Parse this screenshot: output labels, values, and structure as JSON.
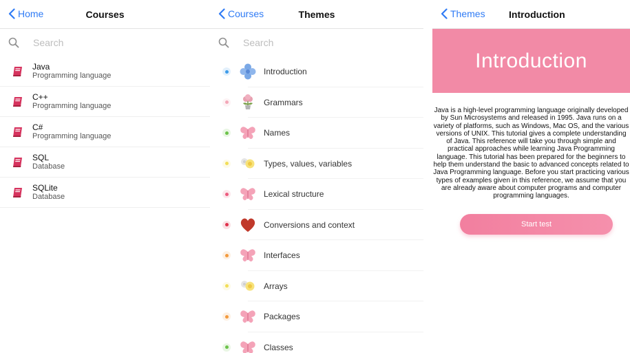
{
  "courses_screen": {
    "back_label": "Home",
    "title": "Courses",
    "search_placeholder": "Search",
    "items": [
      {
        "name": "Java",
        "subtitle": "Programming language"
      },
      {
        "name": "C++",
        "subtitle": "Programming language"
      },
      {
        "name": "C#",
        "subtitle": "Programming language"
      },
      {
        "name": "SQL",
        "subtitle": "Database"
      },
      {
        "name": "SQLite",
        "subtitle": "Database"
      }
    ]
  },
  "themes_screen": {
    "back_label": "Courses",
    "title": "Themes",
    "search_placeholder": "Search",
    "items": [
      {
        "label": "Introduction",
        "dot_color": "#3d9be9",
        "icon": "blue-flower-icon"
      },
      {
        "label": "Grammars",
        "dot_color": "#f3a7b8",
        "icon": "potted-flower-icon"
      },
      {
        "label": "Names",
        "dot_color": "#6cc24a",
        "icon": "pink-butterfly-icon"
      },
      {
        "label": "Types, values, variables",
        "dot_color": "#f2de57",
        "icon": "yellow-flower-icon"
      },
      {
        "label": "Lexical structure",
        "dot_color": "#ec5b7e",
        "icon": "pink-butterfly-icon"
      },
      {
        "label": "Conversions and context",
        "dot_color": "#e0304a",
        "icon": "heart-icon"
      },
      {
        "label": "Interfaces",
        "dot_color": "#f39a3d",
        "icon": "pink-butterfly-icon"
      },
      {
        "label": "Arrays",
        "dot_color": "#f2de57",
        "icon": "yellow-flower-icon"
      },
      {
        "label": "Packages",
        "dot_color": "#f39a3d",
        "icon": "pink-butterfly-icon"
      },
      {
        "label": "Classes",
        "dot_color": "#6cc24a",
        "icon": "pink-butterfly-icon"
      }
    ]
  },
  "intro_screen": {
    "back_label": "Themes",
    "title": "Introduction",
    "banner_title": "Introduction",
    "body": "Java is a high-level programming language originally developed by Sun Microsystems and released in 1995. Java runs on a variety of platforms, such as Windows, Mac OS, and the various versions of UNIX. This tutorial gives a complete understanding of Java. This reference will take you through simple and practical approaches while learning Java Programming language. This tutorial has been prepared for the beginners to help them understand the basic to advanced concepts related to Java Programming language. Before you start practicing various types of examples given in this reference, we assume that you are already aware about computer programs and computer programming languages.",
    "start_button": "Start test"
  },
  "colors": {
    "accent_blue": "#2f7bf5",
    "book_red": "#d6335e",
    "banner_pink": "#f28aa6"
  }
}
